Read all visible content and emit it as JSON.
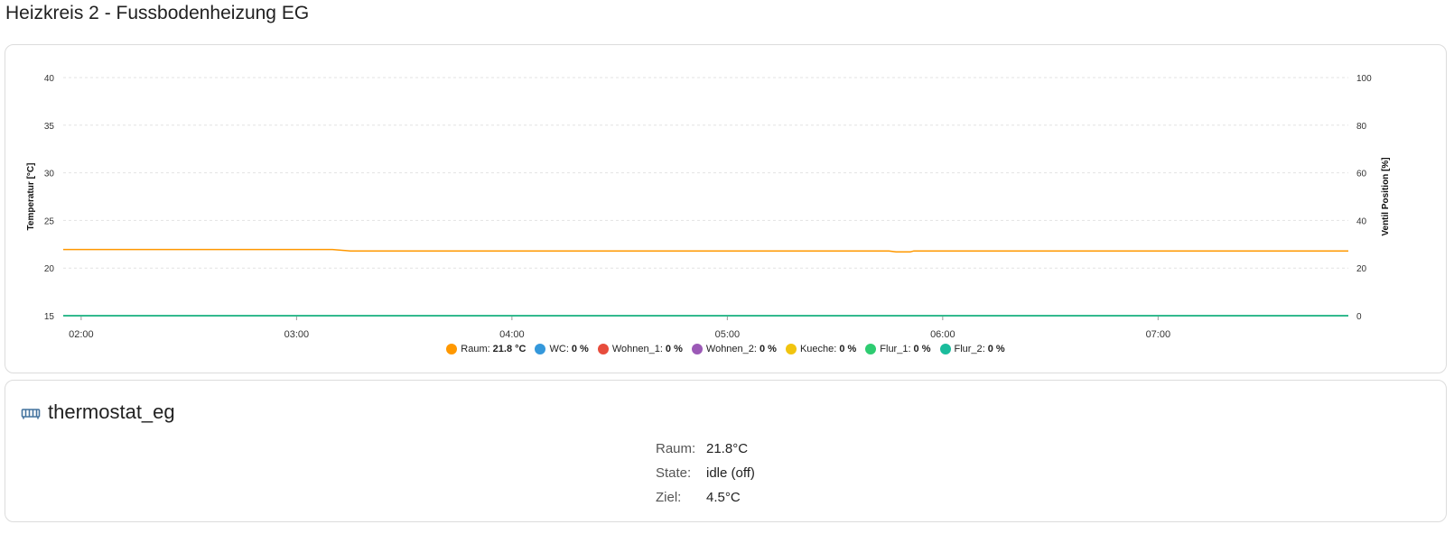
{
  "page": {
    "title": "Heizkreis 2 - Fussbodenheizung EG"
  },
  "chart_data": {
    "type": "line",
    "x": [
      "01:55",
      "02:30",
      "03:00",
      "03:10",
      "03:15",
      "03:20",
      "03:30",
      "03:45",
      "04:30",
      "05:00",
      "05:30",
      "05:45",
      "05:47",
      "05:51",
      "05:52",
      "06:30",
      "07:30",
      "07:53"
    ],
    "x_ticks": [
      "02:00",
      "03:00",
      "04:00",
      "05:00",
      "06:00",
      "07:00"
    ],
    "xlim": [
      "01:55",
      "07:53"
    ],
    "ylabel": "Temperatur [°C]",
    "ylim": [
      15,
      40
    ],
    "y_ticks": [
      15,
      20,
      25,
      30,
      35,
      40
    ],
    "y2label": "Ventil Position [%]",
    "y2lim": [
      0,
      100
    ],
    "y2_ticks": [
      0,
      20,
      40,
      60,
      80,
      100
    ],
    "grid": true,
    "legend": "bottom",
    "series": [
      {
        "name": "Raum",
        "axis": "left",
        "color": "#ff9800",
        "legend_value": "21.8 °C",
        "values": [
          21.95,
          21.95,
          21.95,
          21.95,
          21.8,
          21.8,
          21.8,
          21.8,
          21.8,
          21.8,
          21.8,
          21.8,
          21.7,
          21.7,
          21.8,
          21.8,
          21.8,
          21.8
        ]
      },
      {
        "name": "WC",
        "axis": "right",
        "color": "#3498db",
        "legend_value": "0 %",
        "values": [
          0,
          0,
          0,
          0,
          0,
          0,
          0,
          0,
          0,
          0,
          0,
          0,
          0,
          0,
          0,
          0,
          0,
          0
        ]
      },
      {
        "name": "Wohnen_1",
        "axis": "right",
        "color": "#e74c3c",
        "legend_value": "0 %",
        "values": [
          0,
          0,
          0,
          0,
          0,
          0,
          0,
          0,
          0,
          0,
          0,
          0,
          0,
          0,
          0,
          0,
          0,
          0
        ]
      },
      {
        "name": "Wohnen_2",
        "axis": "right",
        "color": "#9b59b6",
        "legend_value": "0 %",
        "values": [
          0,
          0,
          0,
          0,
          0,
          0,
          0,
          0,
          0,
          0,
          0,
          0,
          0,
          0,
          0,
          0,
          0,
          0
        ]
      },
      {
        "name": "Kueche",
        "axis": "right",
        "color": "#f1c40f",
        "legend_value": "0 %",
        "values": [
          0,
          0,
          0,
          0,
          0,
          0,
          0,
          0,
          0,
          0,
          0,
          0,
          0,
          0,
          0,
          0,
          0,
          0
        ]
      },
      {
        "name": "Flur_1",
        "axis": "right",
        "color": "#2ecc71",
        "legend_value": "0 %",
        "values": [
          0,
          0,
          0,
          0,
          0,
          0,
          0,
          0,
          0,
          0,
          0,
          0,
          0,
          0,
          0,
          0,
          0,
          0
        ]
      },
      {
        "name": "Flur_2",
        "axis": "right",
        "color": "#1abc9c",
        "legend_value": "0 %",
        "values": [
          0,
          0,
          0,
          0,
          0,
          0,
          0,
          0,
          0,
          0,
          0,
          0,
          0,
          0,
          0,
          0,
          0,
          0
        ]
      }
    ]
  },
  "entity": {
    "icon": "radiator-icon",
    "name": "thermostat_eg",
    "icon_color": "#44739e",
    "attributes": [
      {
        "label": "Raum:",
        "value": "21.8°C"
      },
      {
        "label": "State:",
        "value": "idle (off)"
      },
      {
        "label": "Ziel:",
        "value": "4.5°C"
      }
    ]
  }
}
